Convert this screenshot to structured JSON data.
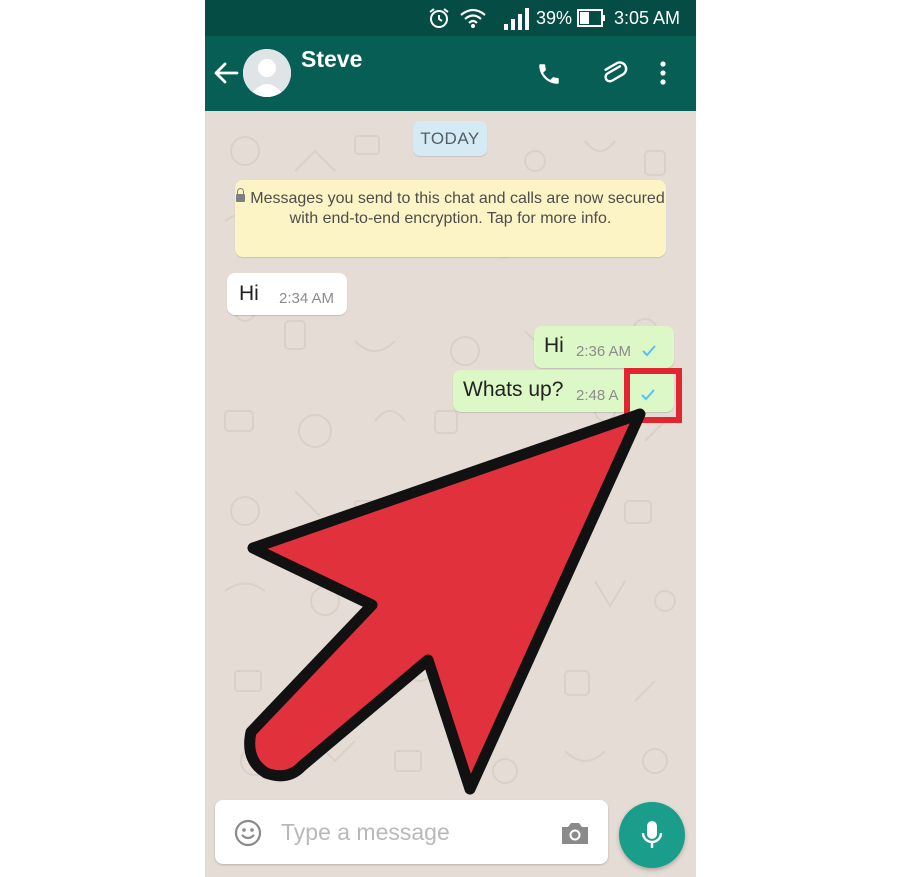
{
  "status_bar": {
    "battery": "39%",
    "time": "3:05 AM",
    "icons": [
      "alarm-icon",
      "wifi-icon",
      "signal-icon",
      "battery-icon"
    ]
  },
  "header": {
    "contact_name": "Steve",
    "icons": [
      "back-arrow-icon",
      "avatar-icon",
      "phone-icon",
      "paperclip-icon",
      "more-vert-icon"
    ]
  },
  "chat": {
    "date_label": "TODAY",
    "encryption_notice": "Messages you send to this chat and calls are now secured with end-to-end encryption. Tap for more info.",
    "messages": [
      {
        "direction": "incoming",
        "text": "Hi",
        "time": "2:34 AM"
      },
      {
        "direction": "outgoing",
        "text": "Hi",
        "time": "2:36 AM",
        "status": "sent-single-tick"
      },
      {
        "direction": "outgoing",
        "text": "Whats up?",
        "time": "2:48 A",
        "status": "sent-single-tick"
      }
    ]
  },
  "composer": {
    "placeholder": "Type a message",
    "icons": [
      "emoji-icon",
      "camera-icon",
      "mic-icon"
    ]
  },
  "annotation": {
    "highlight_color": "#e0262f",
    "arrow_color": "#e0313d"
  },
  "colors": {
    "header": "#075e54",
    "status_bar": "#054d44",
    "outgoing_bubble": "#dcf8c6",
    "tick": "#4fc3f7",
    "mic_button": "#1a9e8b"
  }
}
